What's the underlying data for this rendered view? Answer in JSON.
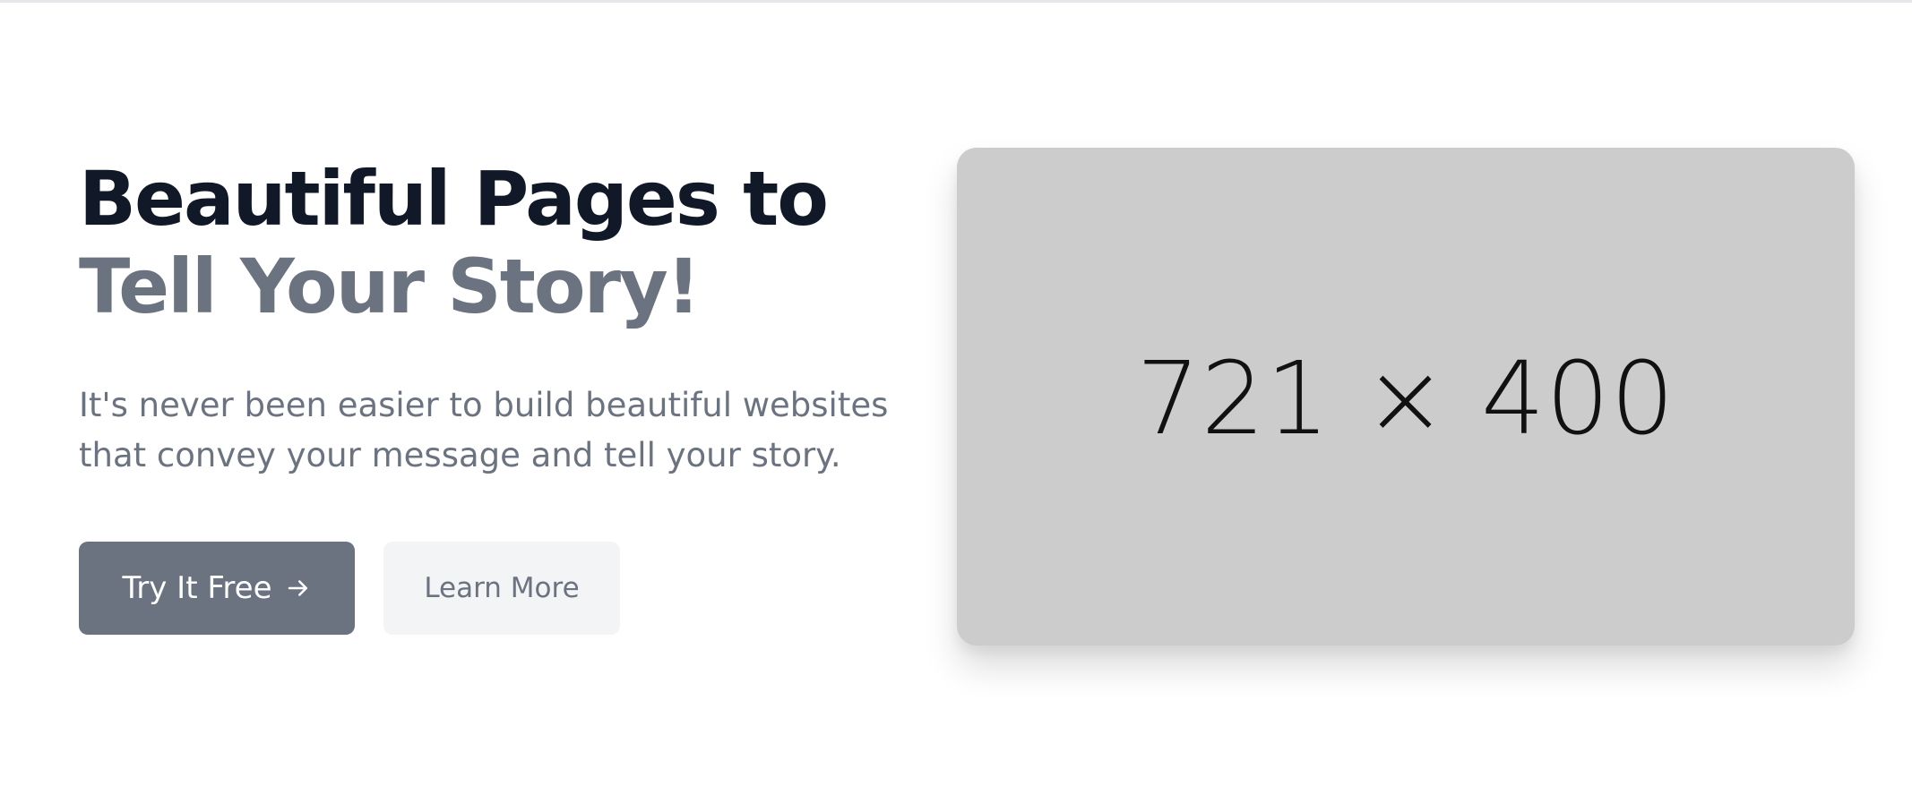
{
  "hero": {
    "title_line1": "Beautiful Pages to",
    "title_line2": "Tell Your Story!",
    "subtitle": "It's never been easier to build beautiful websites that convey your message and tell your story.",
    "primary_button": {
      "label": "Try It Free",
      "icon": "arrow-right-icon"
    },
    "secondary_button": {
      "label": "Learn More"
    }
  },
  "image_placeholder": {
    "label": "721 × 400"
  },
  "colors": {
    "heading_dark": "#111827",
    "heading_muted": "#6b7280",
    "primary_button_bg": "#6b7280",
    "secondary_button_bg": "#f3f4f6",
    "placeholder_bg": "#cccccc"
  }
}
